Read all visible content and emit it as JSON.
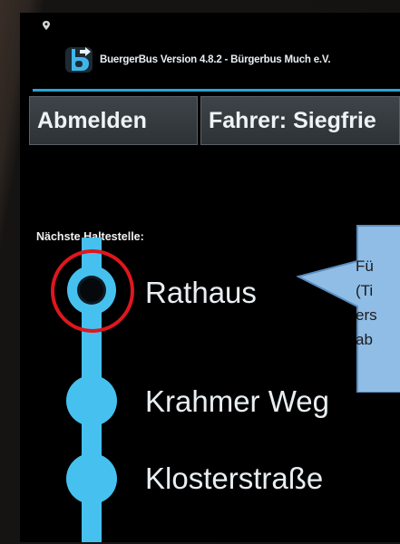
{
  "app": {
    "title": "BuergerBus Version 4.8.2 - Bürgerbus Much e.V."
  },
  "toolbar": {
    "logout_label": "Abmelden",
    "driver_label": "Fahrer: Siegfrie"
  },
  "route": {
    "next_stop_label": "Nächste Haltestelle:",
    "stops": [
      {
        "name": "Rathaus",
        "current": true
      },
      {
        "name": "Krahmer Weg",
        "current": false
      },
      {
        "name": "Klosterstraße",
        "current": false
      }
    ]
  },
  "callout": {
    "lines": [
      "Fü",
      "(Ti",
      "ers",
      "ab"
    ]
  },
  "colors": {
    "accent": "#46c1ef",
    "highlight_ring": "#e0161e",
    "callout_fill": "#8fbde6"
  }
}
